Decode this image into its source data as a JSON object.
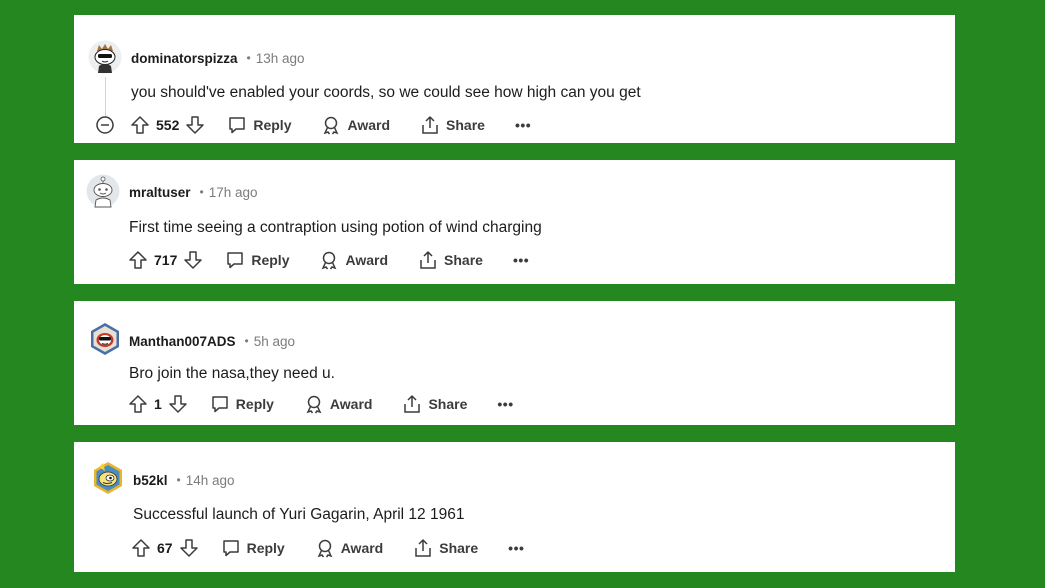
{
  "comments": [
    {
      "username": "dominatorspizza",
      "dot": "•",
      "time": "13h ago",
      "body": "you should've enabled your coords, so we could see how high can you get",
      "score": "552",
      "reply_label": "Reply",
      "award_label": "Award",
      "share_label": "Share",
      "more_label": "•••"
    },
    {
      "username": "mraltuser",
      "dot": "•",
      "time": "17h ago",
      "body": "First time seeing a contraption using potion of wind charging",
      "score": "717",
      "reply_label": "Reply",
      "award_label": "Award",
      "share_label": "Share",
      "more_label": "•••"
    },
    {
      "username": "Manthan007ADS",
      "dot": "•",
      "time": "5h ago",
      "body": "Bro join the nasa,they need u.",
      "score": "1",
      "reply_label": "Reply",
      "award_label": "Award",
      "share_label": "Share",
      "more_label": "•••"
    },
    {
      "username": "b52kl",
      "dot": "•",
      "time": "14h ago",
      "body": "Successful launch of Yuri Gagarin, April 12 1961",
      "score": "67",
      "reply_label": "Reply",
      "award_label": "Award",
      "share_label": "Share",
      "more_label": "•••"
    }
  ],
  "icons": {
    "collapse": "collapse-thread-icon",
    "upvote": "upvote-arrow-icon",
    "downvote": "downvote-arrow-icon",
    "reply": "comment-bubble-icon",
    "award": "award-ribbon-icon",
    "share": "share-upload-icon",
    "more": "more-options-icon"
  },
  "colors": {
    "background": "#25871f",
    "card": "#ffffff",
    "meta_text": "#7c7c7c",
    "action_text": "#3c3c3c"
  }
}
